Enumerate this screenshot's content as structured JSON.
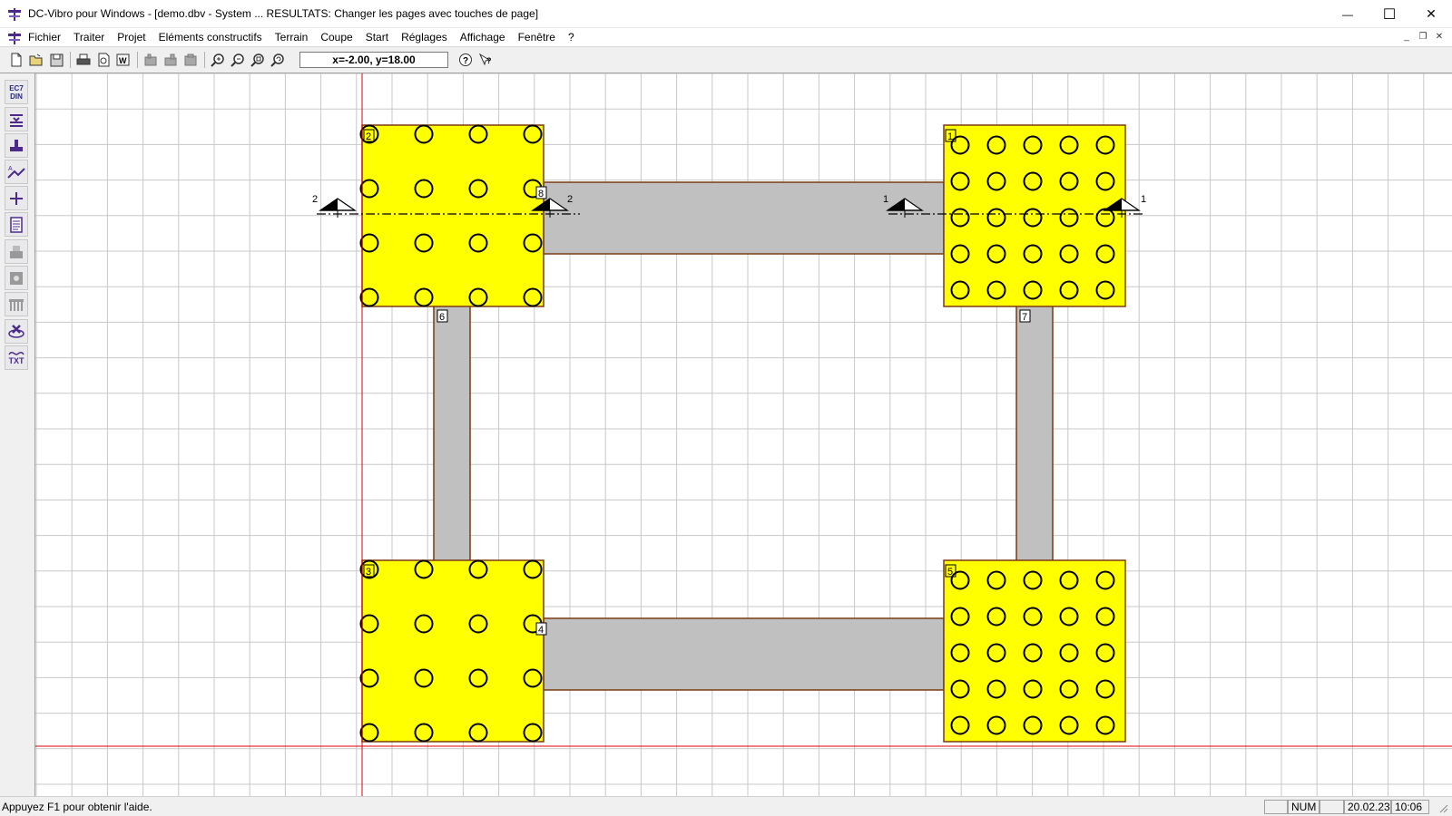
{
  "window": {
    "title": "DC-Vibro pour Windows - [demo.dbv - System ... RESULTATS: Changer les pages avec touches de page]",
    "minimize_glyph": "—",
    "maximize_glyph": "☐",
    "close_glyph": "✕"
  },
  "menu": {
    "items": [
      "Fichier",
      "Traiter",
      "Projet",
      "Eléments constructifs",
      "Terrain",
      "Coupe",
      "Start",
      "Réglages",
      "Affichage",
      "Fenêtre",
      "?"
    ],
    "mdi_minimize": "_",
    "mdi_restore": "❐",
    "mdi_close": "✕"
  },
  "toolbar": {
    "coords": "x=-2.00, y=18.00",
    "icons": [
      "new-file-icon",
      "open-file-icon",
      "save-icon",
      "print-icon",
      "print-preview-icon",
      "export-word-icon",
      "cut-icon",
      "copy-icon",
      "paste-icon",
      "zoom-in-icon",
      "zoom-out-icon",
      "zoom-fit-icon",
      "zoom-previous-icon",
      "help-icon",
      "context-help-icon"
    ]
  },
  "left_toolbar": {
    "ec7_line1": "EC7",
    "ec7_line2": "DIN",
    "txt_label": "TXT"
  },
  "drawing": {
    "foundations": [
      {
        "id": "1",
        "label": "1",
        "pile_cols": 5,
        "pile_rows": 5
      },
      {
        "id": "2",
        "label": "2",
        "pile_cols": 4,
        "pile_rows": 4
      },
      {
        "id": "3",
        "label": "3",
        "pile_cols": 4,
        "pile_rows": 4
      },
      {
        "id": "5",
        "label": "5",
        "pile_cols": 5,
        "pile_rows": 5
      }
    ],
    "beams": [
      {
        "id": "8",
        "label": "8"
      },
      {
        "id": "4",
        "label": "4"
      },
      {
        "id": "6",
        "label": "6"
      },
      {
        "id": "7",
        "label": "7"
      }
    ],
    "sections": [
      {
        "id": "2",
        "left_label": "2",
        "right_label": "2"
      },
      {
        "id": "1",
        "left_label": "1",
        "right_label": "1"
      }
    ],
    "colors": {
      "foundation": "#ffff00",
      "beam": "#c0c0c0",
      "outline": "#7a3a12",
      "axis": "#e00000",
      "grid": "#c8c8c8"
    }
  },
  "status": {
    "help_text": "Appuyez F1 pour obtenir l'aide.",
    "num": "NUM",
    "date": "20.02.23",
    "time": "10:06"
  }
}
